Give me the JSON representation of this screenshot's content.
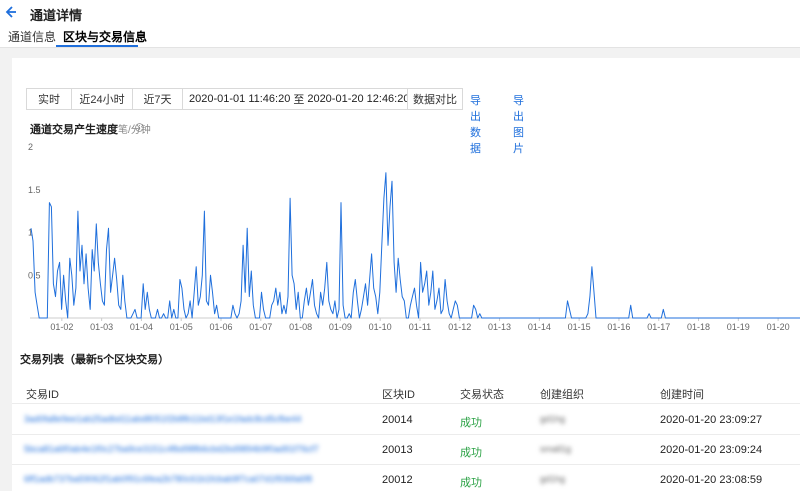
{
  "header": {
    "title": "通道详情"
  },
  "tabs": [
    {
      "label": "通道信息",
      "active": false
    },
    {
      "label": "区块与交易信息",
      "active": true
    }
  ],
  "toolbar": {
    "ranges": [
      "实时",
      "近24小时",
      "近7天"
    ],
    "date_start": "2020-01-01 11:46:20",
    "date_sep": "至",
    "date_end": "2020-01-20 12:46:20",
    "compare_label": "数据对比",
    "export_data": "导出数据",
    "export_image": "导出图片"
  },
  "chart_title": "通道交易产生速度",
  "chart_unit": "笔/分钟",
  "chart_data": {
    "type": "line",
    "title": "通道交易产生速度",
    "ylabel": "笔/分钟",
    "ylim": [
      0,
      2
    ],
    "yticks": [
      "2",
      "1.5",
      "1",
      "0.5"
    ],
    "xticks": [
      "01-02",
      "01-03",
      "01-04",
      "01-05",
      "01-06",
      "01-07",
      "01-08",
      "01-09",
      "01-10",
      "01-11",
      "01-12",
      "01-13",
      "01-14",
      "01-15",
      "01-16",
      "01-17",
      "01-18",
      "01-19",
      "01-20"
    ],
    "x_start_day": 1.2,
    "x_end_day": 20.55,
    "color": "#1f6fdc",
    "values": [
      1.05,
      0.9,
      0.3,
      0.15,
      0,
      0,
      0,
      0,
      0,
      1.35,
      1.3,
      0.4,
      0.25,
      0.55,
      0.65,
      0.1,
      0.5,
      0.2,
      0,
      0.7,
      0.5,
      0.15,
      0.35,
      1.25,
      0.55,
      0.85,
      0.4,
      0.75,
      0.35,
      0.1,
      0.8,
      0.55,
      1.1,
      0.65,
      0.4,
      0.2,
      0.15,
      0.8,
      1.05,
      0.3,
      0.5,
      0.7,
      0.45,
      0.15,
      0.1,
      0.5,
      0.2,
      0,
      0,
      0,
      0.05,
      0.1,
      0,
      0,
      0,
      0.4,
      0.1,
      0.3,
      0.1,
      0,
      0,
      0,
      0.1,
      0,
      0,
      0.05,
      0,
      0,
      0.2,
      0,
      0.1,
      0,
      0,
      0.45,
      0.35,
      0.1,
      0,
      0.05,
      0.2,
      0,
      0.3,
      0.6,
      0.15,
      0.25,
      0.5,
      1.25,
      0.2,
      0.15,
      0.5,
      0.3,
      0.05,
      0.15,
      0,
      0,
      0,
      0,
      0,
      0,
      0,
      0.15,
      0.05,
      0,
      0.05,
      0.2,
      0.85,
      0.3,
      1.05,
      0.25,
      0.55,
      0.15,
      0,
      0,
      0,
      0.3,
      0.1,
      0,
      0,
      0,
      0.15,
      0.2,
      0.35,
      0.15,
      0.3,
      0.05,
      0.15,
      0.05,
      0.25,
      1.4,
      0.5,
      0.4,
      0.1,
      0.3,
      0,
      0,
      0.2,
      0.35,
      0.15,
      0.3,
      0.45,
      0.15,
      0.05,
      0,
      0.3,
      0.15,
      0.35,
      0.65,
      0.2,
      0.1,
      0.05,
      0.2,
      0,
      0.1,
      1.35,
      0.15,
      0,
      0,
      0.05,
      0,
      0.3,
      0.45,
      0.2,
      0,
      0.1,
      0.25,
      0.4,
      0.15,
      0.45,
      0.75,
      0.35,
      0.25,
      0.05,
      0.3,
      0.85,
      1.4,
      1.7,
      0.85,
      1.3,
      1.6,
      0.65,
      0.3,
      0.7,
      0.45,
      0.25,
      0.2,
      0,
      0,
      0.15,
      0.25,
      0.35,
      0.15,
      0,
      0.65,
      0.3,
      0.4,
      0.55,
      0.15,
      0.3,
      0.55,
      0.1,
      0.2,
      0.35,
      0.05,
      0.1,
      0.45,
      0.2,
      0.05,
      0,
      0.1,
      0.2,
      0.15,
      0,
      0,
      0,
      0,
      0,
      0,
      0,
      0.15,
      0.1,
      0,
      0.05,
      0,
      0,
      0,
      0,
      0,
      0,
      0,
      0,
      0,
      0,
      0,
      0,
      0,
      0,
      0,
      0,
      0,
      0,
      0,
      0,
      0,
      0,
      0,
      0,
      0,
      0,
      0,
      0,
      0,
      0,
      0,
      0,
      0,
      0,
      0,
      0,
      0,
      0,
      0,
      0,
      0,
      0,
      0.2,
      0.1,
      0,
      0,
      0,
      0,
      0,
      0,
      0,
      0,
      0.05,
      0.25,
      0.6,
      0.3,
      0,
      0,
      0,
      0,
      0,
      0,
      0,
      0,
      0,
      0,
      0,
      0,
      0,
      0,
      0,
      0,
      0,
      0.15,
      0,
      0,
      0,
      0,
      0,
      0,
      0,
      0,
      0.05,
      0,
      0,
      0,
      0,
      0,
      0,
      0.1,
      0,
      0,
      0,
      0,
      0,
      0,
      0,
      0,
      0,
      0,
      0,
      0,
      0,
      0,
      0,
      0,
      0,
      0,
      0,
      0,
      0,
      0,
      0,
      0,
      0,
      0,
      0,
      0,
      0,
      0,
      0,
      0,
      0,
      0,
      0,
      0,
      0,
      0,
      0,
      0,
      0,
      0,
      0,
      0,
      0,
      0,
      0,
      0,
      0,
      0,
      0,
      0,
      0,
      0,
      0,
      0,
      0,
      0,
      0,
      0,
      0,
      0,
      0,
      0,
      0,
      0,
      0
    ]
  },
  "list": {
    "title": "交易列表（最新5个区块交易）",
    "columns": [
      "交易ID",
      "区块ID",
      "交易状态",
      "创建组织",
      "创建时间"
    ],
    "rows": [
      {
        "tx_id": "3ad0fa8e9ee1ab25adbd11abd8051f2b8fb11bd13f1e1fadc8cd5cfbe44",
        "block_id": "20014",
        "status": "成功",
        "org": "gd1hg",
        "created": "2020-01-20 23:09:27"
      },
      {
        "tx_id": "5bca81a6f0ab4e1f0c27ba9ce3151c4fbd98fb6cbd2bd9894b9f0ad91f76cf7",
        "block_id": "20013",
        "status": "成功",
        "org": "small1g",
        "created": "2020-01-20 23:09:24"
      },
      {
        "tx_id": "6ff1adb737ba59062f1ab0f91c6fea2b780c61b1fcbab9f7ca07d1f936fa6f8",
        "block_id": "20012",
        "status": "成功",
        "org": "gd1hg",
        "created": "2020-01-20 23:08:59"
      }
    ]
  }
}
